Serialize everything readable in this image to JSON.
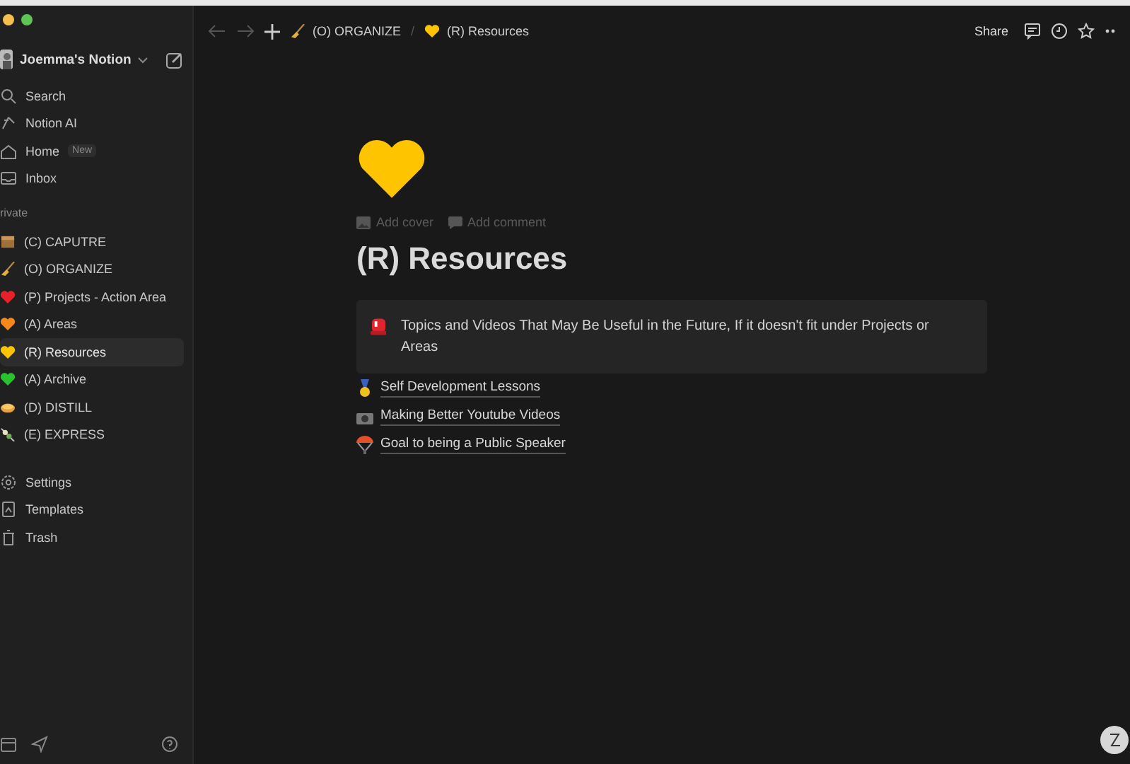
{
  "workspace": {
    "name": "Joemma's Notion"
  },
  "nav": [
    {
      "kind": "search",
      "label": "Search"
    },
    {
      "kind": "ai",
      "label": "Notion AI"
    },
    {
      "kind": "home",
      "label": "Home",
      "badge": "New"
    },
    {
      "kind": "inbox",
      "label": "Inbox"
    }
  ],
  "section_label": "rivate",
  "pages": [
    {
      "kind": "box",
      "label": "(C) CAPUTRE",
      "selected": false
    },
    {
      "kind": "broom",
      "label": "(O) ORGANIZE",
      "selected": false
    },
    {
      "kind": "heart",
      "color": "#e8202a",
      "label": "(P) Projects - Action Area",
      "selected": false
    },
    {
      "kind": "heart",
      "color": "#f4881a",
      "label": "(A) Areas",
      "selected": false
    },
    {
      "kind": "heart",
      "color": "#ffc400",
      "label": "(R) Resources",
      "selected": true
    },
    {
      "kind": "heart",
      "color": "#29c22e",
      "label": "(A) Archive",
      "selected": false
    },
    {
      "kind": "pie",
      "label": "(D) DISTILL",
      "selected": false
    },
    {
      "kind": "skewer",
      "label": "(E) EXPRESS",
      "selected": false
    }
  ],
  "tools": [
    {
      "kind": "settings",
      "label": "Settings"
    },
    {
      "kind": "templates",
      "label": "Templates"
    },
    {
      "kind": "trash",
      "label": "Trash"
    }
  ],
  "breadcrumb_separator": "/",
  "breadcrumb": [
    {
      "kind": "broom",
      "label": "(O) ORGANIZE"
    },
    {
      "kind": "heart",
      "color": "#ffc400",
      "label": "(R) Resources"
    }
  ],
  "share": "Share",
  "page": {
    "add_cover": "Add cover",
    "add_comment": "Add comment",
    "title": "(R) Resources",
    "callout": "Topics and Videos That May Be Useful in the Future, If it doesn't fit under Projects or Areas",
    "links": [
      {
        "kind": "medal",
        "label": "Self Development Lessons"
      },
      {
        "kind": "camera",
        "label": "Making Better Youtube Videos"
      },
      {
        "kind": "parachute",
        "label": "Goal to being a Public Speaker"
      }
    ]
  }
}
